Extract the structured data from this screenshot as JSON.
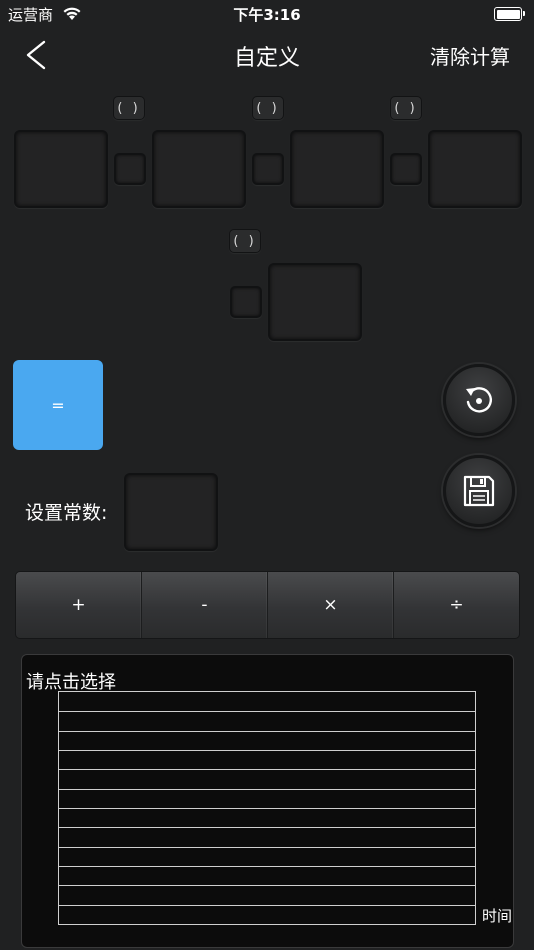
{
  "status_bar": {
    "carrier": "运营商",
    "time": "下午3:16"
  },
  "nav": {
    "back_icon": "chevron-left-icon",
    "title": "自定义",
    "clear_label": "清除计算"
  },
  "formula": {
    "paren_label": "( )",
    "equals_label": "="
  },
  "actions": {
    "reset_icon": "rotate-ccw-icon",
    "save_icon": "floppy-disk-icon"
  },
  "constant": {
    "label": "设置常数:"
  },
  "operators": [
    "+",
    "-",
    "×",
    "÷"
  ],
  "chart": {
    "prompt": "请点击选择",
    "xlabel": "时间"
  },
  "colors": {
    "background": "#202122",
    "equals_button": "#4aa8f0"
  }
}
